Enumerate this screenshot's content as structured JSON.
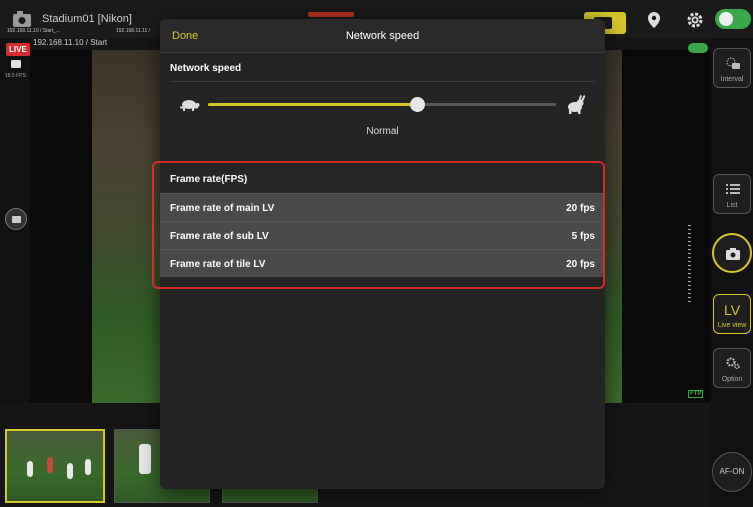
{
  "app": {
    "camera_name": "Stadium01 [Nikon]",
    "live_badge": "LIVE",
    "fps_readout": "18.5 FPS",
    "view_header": "192.168.11.10 / Start",
    "ftp_badge": "FTP"
  },
  "right_panel": {
    "interval_label": "Interval",
    "list_label": "List",
    "lv_text": "LV",
    "lv_label": "Live view",
    "option_label": "Option",
    "afon_label": "AF-ON"
  },
  "thumbnails": {
    "label_1": "192.168.11.10 / Start_...",
    "label_2": "192.168.11.11 /"
  },
  "modal": {
    "done_label": "Done",
    "title": "Network speed",
    "section_label": "Network speed",
    "slider_level": 0.6,
    "speed_value": "Normal",
    "frame_rate_header": "Frame rate(FPS)",
    "rows": [
      {
        "label": "Frame rate of main LV",
        "value": "20 fps"
      },
      {
        "label": "Frame rate of sub LV",
        "value": "5 fps"
      },
      {
        "label": "Frame rate of tile LV",
        "value": "20 fps"
      }
    ]
  },
  "colors": {
    "accent_yellow": "#d5c72a",
    "live_red": "#d42d2d",
    "highlight_red": "#d62a2a",
    "toggle_green": "#3aa84a"
  }
}
